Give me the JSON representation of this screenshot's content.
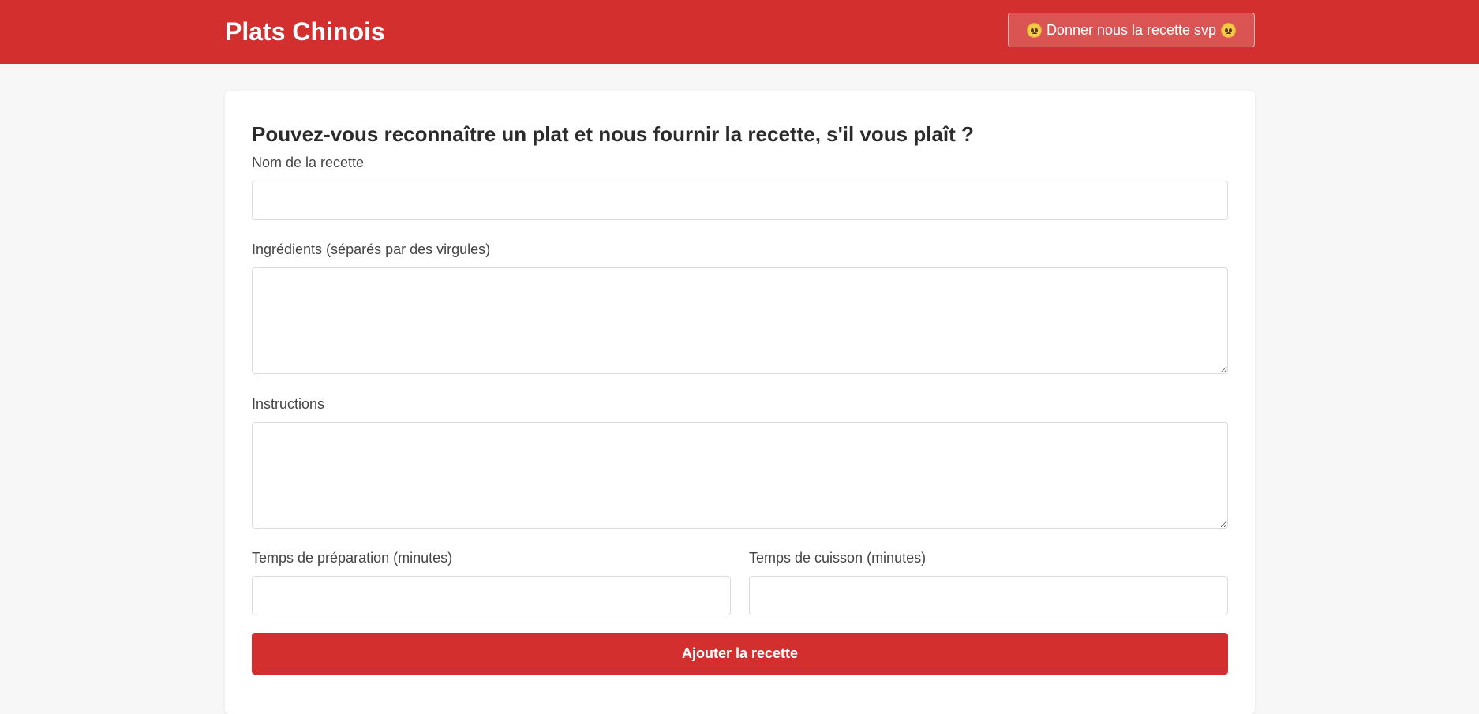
{
  "header": {
    "brand": "Plats Chinois",
    "plea_button_label": "Donner nous la recette svp",
    "plea_button_icon": "pleading-face-emoji-icon",
    "background_color": "#d32f2f"
  },
  "form": {
    "title": "Pouvez-vous reconnaître un plat et nous fournir la recette, s'il vous plaît ?",
    "fields": {
      "name": {
        "label": "Nom de la recette",
        "value": ""
      },
      "ingredients": {
        "label": "Ingrédients (séparés par des virgules)",
        "value": ""
      },
      "instructions": {
        "label": "Instructions",
        "value": ""
      },
      "prep_time": {
        "label": "Temps de préparation (minutes)",
        "value": ""
      },
      "cook_time": {
        "label": "Temps de cuisson (minutes)",
        "value": ""
      }
    },
    "submit_label": "Ajouter la recette",
    "accent_color": "#d32f2f"
  }
}
